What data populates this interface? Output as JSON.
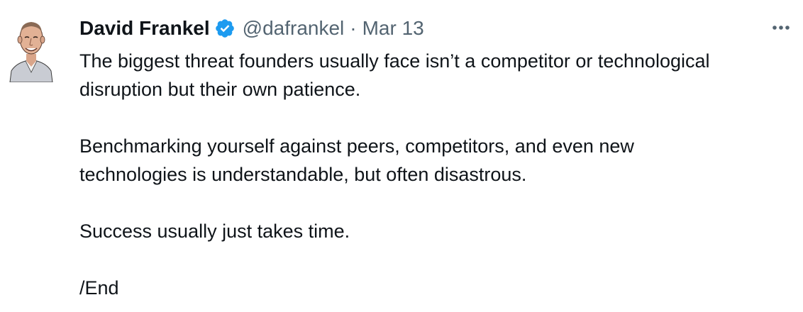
{
  "tweet": {
    "author": {
      "name": "David Frankel",
      "handle": "@dafrankel",
      "verified": true,
      "avatar_icon": "profile-photo"
    },
    "separator": "·",
    "date": "Mar 13",
    "more_icon": "more-horizontal-icon",
    "paragraphs": [
      {
        "lines": [
          "The biggest threat founders usually face isn’t a competitor or technological",
          "disruption but their own patience."
        ]
      },
      {
        "lines": [
          "Benchmarking yourself against peers, competitors, and even new",
          "technologies is understandable, but often disastrous."
        ]
      },
      {
        "lines": [
          "Success usually just takes time."
        ]
      },
      {
        "lines": [
          "/End"
        ]
      }
    ]
  },
  "colors": {
    "text_primary": "#0f1419",
    "text_secondary": "#536471",
    "verified_blue": "#1d9bf0",
    "background": "#ffffff"
  }
}
